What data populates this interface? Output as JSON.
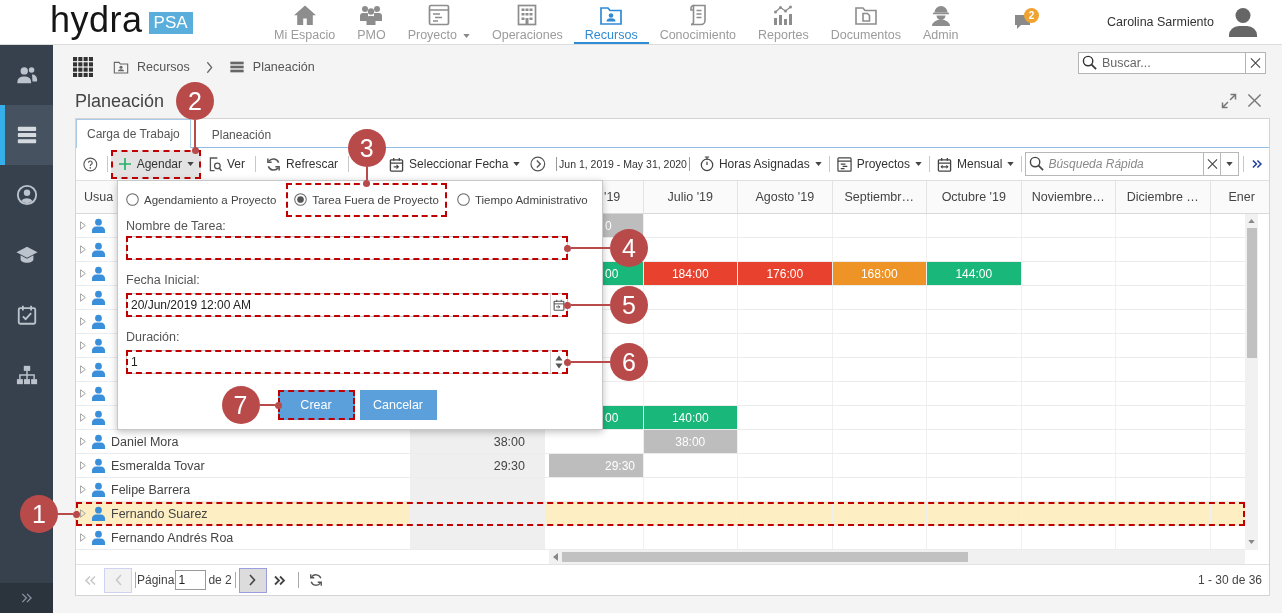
{
  "header": {
    "logo": {
      "name": "hydra",
      "tag": "PSA"
    },
    "nav": [
      {
        "label": "Mi Espacio",
        "selected": false,
        "dropdown": false
      },
      {
        "label": "PMO",
        "selected": false,
        "dropdown": false
      },
      {
        "label": "Proyecto",
        "selected": false,
        "dropdown": true
      },
      {
        "label": "Operaciones",
        "selected": false,
        "dropdown": false
      },
      {
        "label": "Recursos",
        "selected": true,
        "dropdown": false
      },
      {
        "label": "Conocimiento",
        "selected": false,
        "dropdown": false
      },
      {
        "label": "Reportes",
        "selected": false,
        "dropdown": false
      },
      {
        "label": "Documentos",
        "selected": false,
        "dropdown": false
      },
      {
        "label": "Admin",
        "selected": false,
        "dropdown": false
      }
    ],
    "notifications": {
      "count": "2"
    },
    "user": {
      "name": "Carolina Sarmiento"
    }
  },
  "sidebar": {
    "items": [
      {
        "selected": false
      },
      {
        "selected": true
      },
      {
        "selected": false
      },
      {
        "selected": false
      },
      {
        "selected": false
      },
      {
        "selected": false
      }
    ]
  },
  "breadcrumb": [
    {
      "label": "Recursos"
    },
    {
      "label": "Planeación"
    }
  ],
  "search": {
    "placeholder": "Buscar..."
  },
  "page_title": "Planeación",
  "tabs": [
    {
      "label": "Carga de Trabajo",
      "selected": true
    },
    {
      "label": "Planeación",
      "selected": false
    }
  ],
  "toolbar": {
    "actions": [
      {
        "label": "Agendar",
        "dropdown": true,
        "pressed": true,
        "callout": "2"
      },
      {
        "label": "Ver",
        "dropdown": false,
        "pressed": false
      },
      {
        "label": "Refrescar",
        "dropdown": false,
        "pressed": false
      }
    ],
    "date_picker": {
      "label": "Seleccionar Fecha"
    },
    "date_range": "Jun 1, 2019 - May 31, 2020",
    "filters": [
      {
        "label": "Horas Asignadas"
      },
      {
        "label": "Proyectos"
      },
      {
        "label": "Mensual"
      }
    ],
    "quick_search": {
      "placeholder": "Búsqueda Rápida"
    }
  },
  "schedule_popup": {
    "options": [
      {
        "label": "Agendamiento a Proyecto",
        "selected": false
      },
      {
        "label": "Tarea Fuera de Proyecto",
        "selected": true,
        "callout": "3"
      },
      {
        "label": "Tiempo Administrativo",
        "selected": false
      }
    ],
    "fields": [
      {
        "kind": "text",
        "label": "Nombre de Tarea:",
        "callout": "4"
      },
      {
        "kind": "date",
        "label": "Fecha Inicial:",
        "value": "20/Jun/2019 12:00 AM",
        "callout": "5"
      },
      {
        "kind": "number",
        "label": "Duración:",
        "value": "1",
        "callout": "6"
      }
    ],
    "buttons": [
      {
        "label": "Crear",
        "callout": "7"
      },
      {
        "label": "Cancelar"
      }
    ]
  },
  "grid": {
    "user_column": "Usua",
    "month_columns": [
      "'19",
      "Julio '19",
      "Agosto '19",
      "Septiembr…",
      "Octubre '19",
      "Noviembre…",
      "Diciembre …",
      "Ener"
    ],
    "rows": [
      {
        "expanded": false,
        "selected": false,
        "months": [
          {
            "text": "0",
            "color": "#bdbdbd"
          }
        ]
      },
      {
        "expanded": false,
        "selected": false
      },
      {
        "expanded": false,
        "selected": false,
        "months": [
          {
            "text": "00",
            "color": "#1ab77b"
          },
          {
            "text": "184:00",
            "color": "#e8422f"
          },
          {
            "text": "176:00",
            "color": "#e8422f"
          },
          {
            "text": "168:00",
            "color": "#ee9426"
          },
          {
            "text": "144:00",
            "color": "#1ab77b"
          }
        ]
      },
      {
        "expanded": false,
        "selected": false
      },
      {
        "expanded": false,
        "selected": false
      },
      {
        "expanded": false,
        "selected": false
      },
      {
        "expanded": false,
        "selected": false
      },
      {
        "expanded": false,
        "selected": false
      },
      {
        "expanded": false,
        "selected": false,
        "months": [
          {
            "text": "00",
            "color": "#1ab77b"
          },
          {
            "text": "140:00",
            "color": "#1ab77b"
          }
        ]
      },
      {
        "name": "Daniel Mora",
        "total": "38:00",
        "expanded": false,
        "selected": false,
        "months": [
          {
            "color": "#ffffff"
          },
          {
            "text": "38:00",
            "color": "#bdbdbd"
          }
        ]
      },
      {
        "name": "Esmeralda Tovar",
        "total": "29:30",
        "expanded": false,
        "selected": false,
        "months": [
          {
            "text": "29:30",
            "color": "#bdbdbd"
          }
        ]
      },
      {
        "name": "Felipe Barrera",
        "expanded": false,
        "selected": false
      },
      {
        "name": "Fernando Suarez",
        "expanded": false,
        "selected": true,
        "callout": "1"
      },
      {
        "name": "Fernando Andrés Roa",
        "expanded": false,
        "selected": false
      }
    ]
  },
  "pager": {
    "label": "Página",
    "page": "1",
    "total": "de 2",
    "summary": "1 - 30 de 36",
    "buttons": [
      {
        "disabled": true
      },
      {
        "disabled": true
      },
      {
        "disabled": false
      },
      {
        "disabled": false
      }
    ]
  }
}
